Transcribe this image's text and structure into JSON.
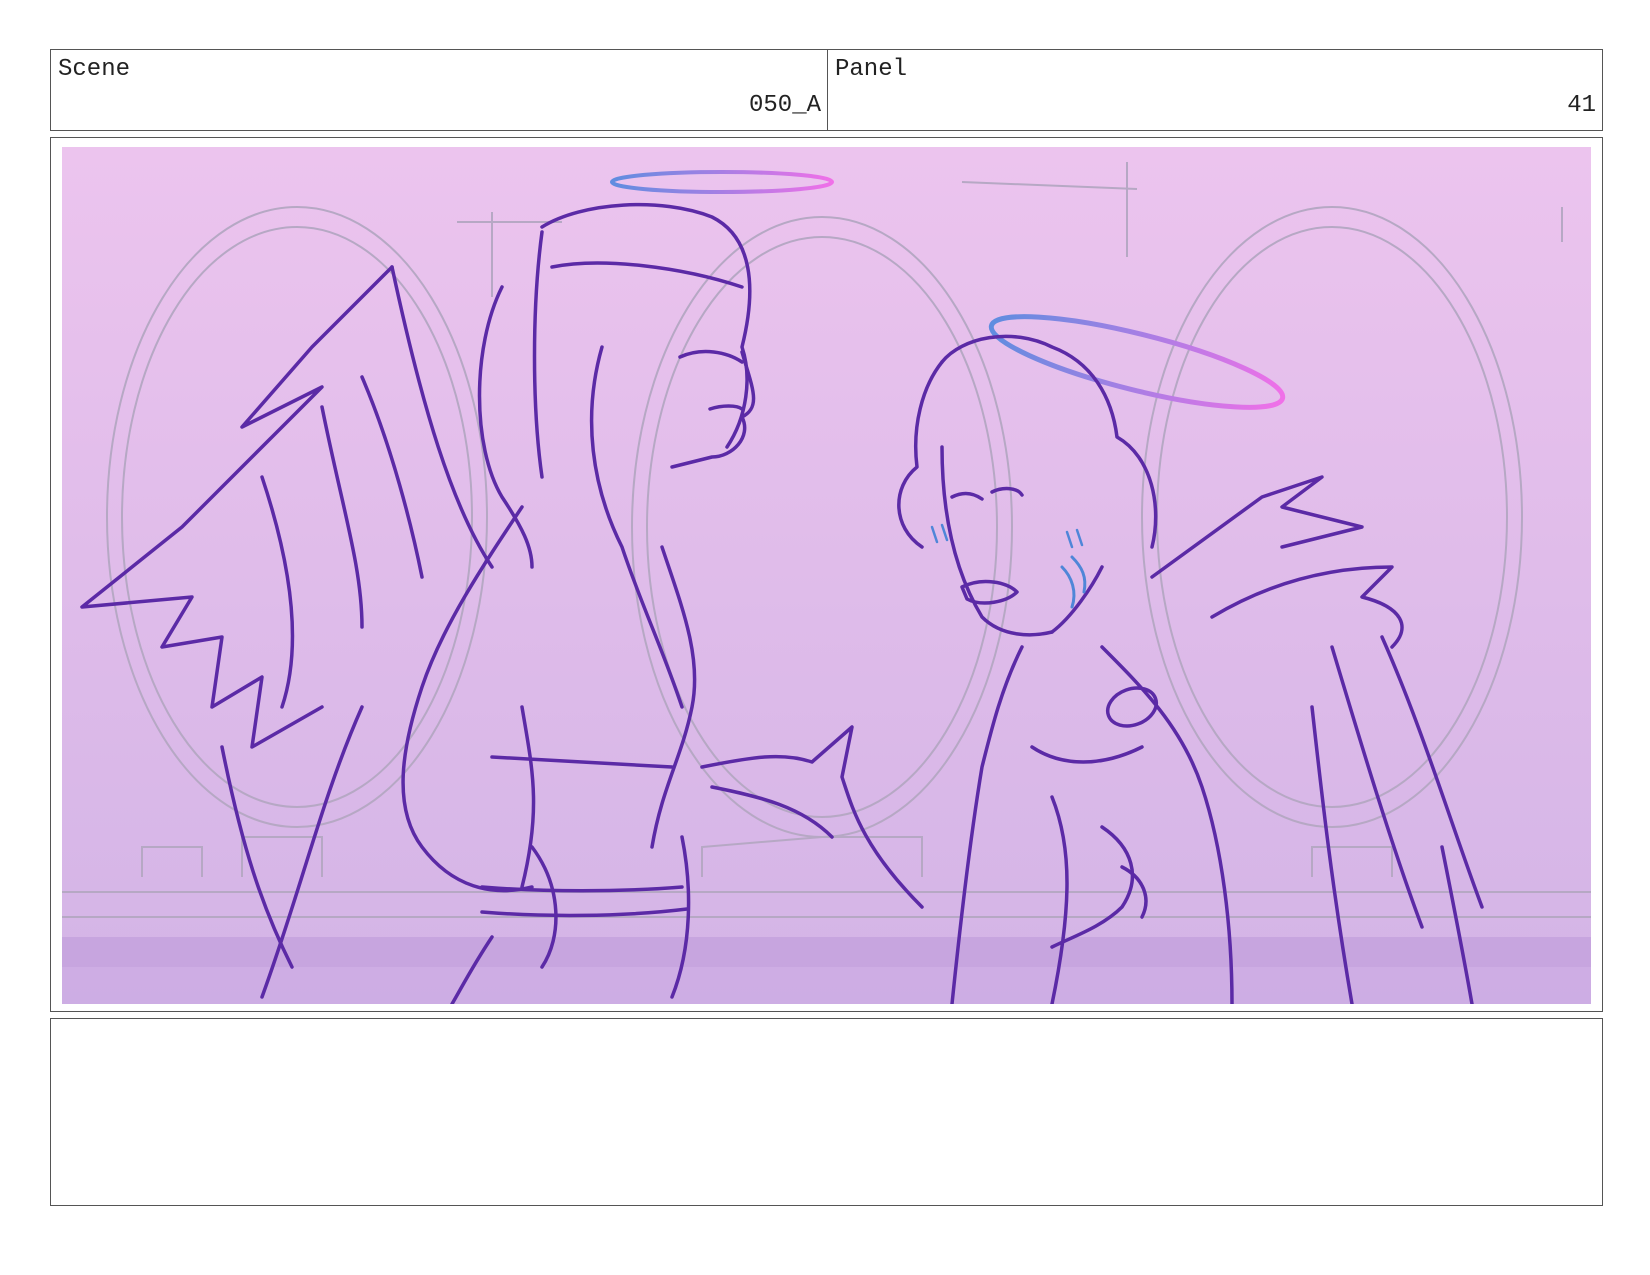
{
  "header": {
    "scene_label": "Scene",
    "scene_value": "050_A",
    "panel_label": "Panel",
    "panel_value": "41"
  },
  "artwork": {
    "colors": {
      "sky_top": "#ecc4ee",
      "sky_bottom": "#d3b4e6",
      "lineart": "#5b2aa6",
      "halo_blue": "#5f8de0",
      "halo_pink": "#f070e8",
      "sketch_grey": "#b6a8c4"
    }
  },
  "notes": {
    "text": ""
  }
}
